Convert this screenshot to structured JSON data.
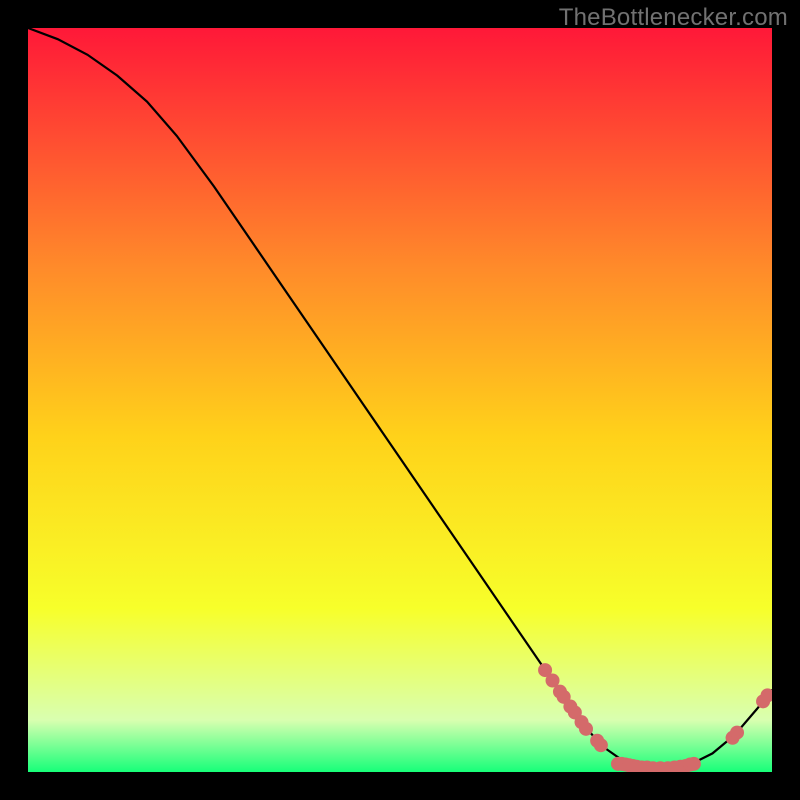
{
  "watermark": "TheBottlenecker.com",
  "colors": {
    "frame": "#000000",
    "curve": "#000000",
    "marker": "#d46a6a",
    "gradient_top": "#ff1838",
    "gradient_mid_upper": "#ff8a2a",
    "gradient_mid": "#ffd21a",
    "gradient_mid_lower": "#f7ff2a",
    "gradient_near_bottom": "#d9ffb0",
    "gradient_bottom": "#17ff79"
  },
  "chart_data": {
    "type": "line",
    "title": "",
    "xlabel": "",
    "ylabel": "",
    "xlim": [
      0,
      100
    ],
    "ylim": [
      0,
      100
    ],
    "curve": [
      {
        "x": 0,
        "y": 100
      },
      {
        "x": 4,
        "y": 98.5
      },
      {
        "x": 8,
        "y": 96.4
      },
      {
        "x": 12,
        "y": 93.6
      },
      {
        "x": 16,
        "y": 90.1
      },
      {
        "x": 20,
        "y": 85.5
      },
      {
        "x": 25,
        "y": 78.7
      },
      {
        "x": 30,
        "y": 71.4
      },
      {
        "x": 35,
        "y": 64.1
      },
      {
        "x": 40,
        "y": 56.8
      },
      {
        "x": 45,
        "y": 49.5
      },
      {
        "x": 50,
        "y": 42.2
      },
      {
        "x": 55,
        "y": 34.9
      },
      {
        "x": 60,
        "y": 27.6
      },
      {
        "x": 65,
        "y": 20.3
      },
      {
        "x": 70,
        "y": 13.0
      },
      {
        "x": 74,
        "y": 7.2
      },
      {
        "x": 77,
        "y": 3.6
      },
      {
        "x": 80,
        "y": 1.5
      },
      {
        "x": 83,
        "y": 0.6
      },
      {
        "x": 86,
        "y": 0.5
      },
      {
        "x": 89,
        "y": 1.0
      },
      {
        "x": 92,
        "y": 2.5
      },
      {
        "x": 95,
        "y": 5.0
      },
      {
        "x": 98,
        "y": 8.5
      },
      {
        "x": 100,
        "y": 11.0
      }
    ],
    "markers": [
      {
        "x": 69.5,
        "y": 13.7
      },
      {
        "x": 70.5,
        "y": 12.3
      },
      {
        "x": 71.5,
        "y": 10.8
      },
      {
        "x": 72.0,
        "y": 10.1
      },
      {
        "x": 72.9,
        "y": 8.8
      },
      {
        "x": 73.5,
        "y": 8.0
      },
      {
        "x": 74.4,
        "y": 6.7
      },
      {
        "x": 75.0,
        "y": 5.8
      },
      {
        "x": 76.5,
        "y": 4.2
      },
      {
        "x": 77.0,
        "y": 3.6
      },
      {
        "x": 79.3,
        "y": 1.1
      },
      {
        "x": 79.8,
        "y": 1.1
      },
      {
        "x": 80.3,
        "y": 1.0
      },
      {
        "x": 80.8,
        "y": 0.9
      },
      {
        "x": 81.3,
        "y": 0.8
      },
      {
        "x": 81.8,
        "y": 0.7
      },
      {
        "x": 82.5,
        "y": 0.6
      },
      {
        "x": 83.2,
        "y": 0.6
      },
      {
        "x": 84.0,
        "y": 0.5
      },
      {
        "x": 85.0,
        "y": 0.5
      },
      {
        "x": 86.0,
        "y": 0.5
      },
      {
        "x": 86.9,
        "y": 0.6
      },
      {
        "x": 87.7,
        "y": 0.7
      },
      {
        "x": 88.4,
        "y": 0.8
      },
      {
        "x": 89.0,
        "y": 1.0
      },
      {
        "x": 89.5,
        "y": 1.1
      },
      {
        "x": 94.7,
        "y": 4.6
      },
      {
        "x": 95.3,
        "y": 5.3
      },
      {
        "x": 98.8,
        "y": 9.5
      },
      {
        "x": 99.4,
        "y": 10.3
      }
    ]
  }
}
